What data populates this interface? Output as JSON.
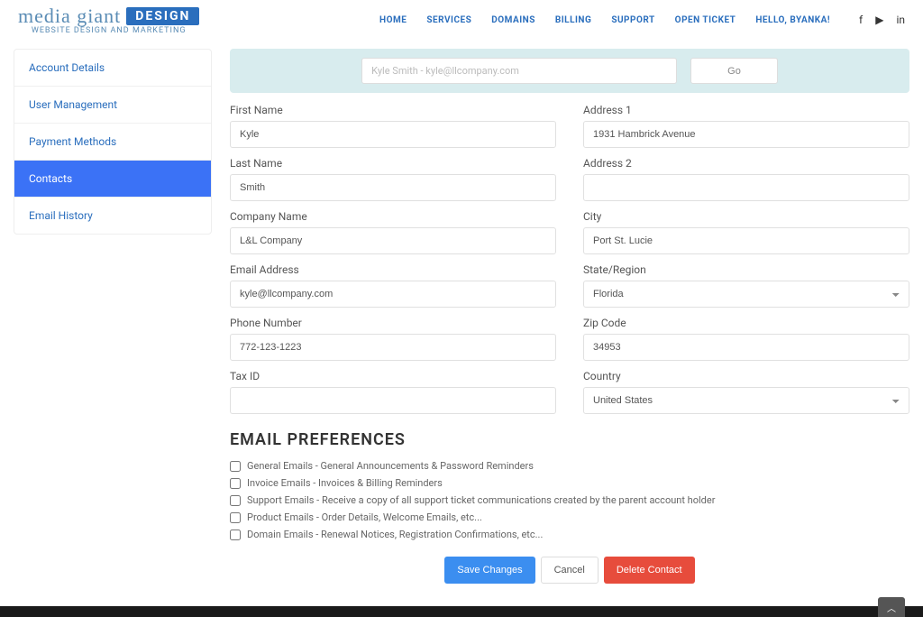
{
  "logo": {
    "text": "media giant",
    "design": "DESIGN",
    "sub": "WEBSITE DESIGN AND MARKETING"
  },
  "nav": {
    "home": "HOME",
    "services": "SERVICES",
    "domains": "DOMAINS",
    "billing": "BILLING",
    "support": "SUPPORT",
    "open_ticket": "OPEN TICKET",
    "hello": "HELLO, BYANKA!"
  },
  "sidebar": {
    "items": [
      {
        "label": "Account Details"
      },
      {
        "label": "User Management"
      },
      {
        "label": "Payment Methods"
      },
      {
        "label": "Contacts"
      },
      {
        "label": "Email History"
      }
    ]
  },
  "alert": {
    "field": "Kyle Smith - kyle@llcompany.com",
    "btn": "Go"
  },
  "labels": {
    "first_name": "First Name",
    "last_name": "Last Name",
    "company_name": "Company Name",
    "email": "Email Address",
    "phone": "Phone Number",
    "tax_id": "Tax ID",
    "address1": "Address 1",
    "address2": "Address 2",
    "city": "City",
    "state": "State/Region",
    "zip": "Zip Code",
    "country": "Country"
  },
  "values": {
    "first_name": "Kyle",
    "last_name": "Smith",
    "company_name": "L&L Company",
    "email": "kyle@llcompany.com",
    "phone": "772-123-1223",
    "tax_id": "",
    "address1": "1931 Hambrick Avenue",
    "address2": "",
    "city": "Port St. Lucie",
    "state": "Florida",
    "zip": "34953",
    "country": "United States"
  },
  "prefs": {
    "title": "EMAIL PREFERENCES",
    "items": [
      "General Emails - General Announcements & Password Reminders",
      "Invoice Emails - Invoices & Billing Reminders",
      "Support Emails - Receive a copy of all support ticket communications created by the parent account holder",
      "Product Emails - Order Details, Welcome Emails, etc...",
      "Domain Emails - Renewal Notices, Registration Confirmations, etc..."
    ]
  },
  "actions": {
    "save": "Save Changes",
    "cancel": "Cancel",
    "delete": "Delete Contact"
  }
}
